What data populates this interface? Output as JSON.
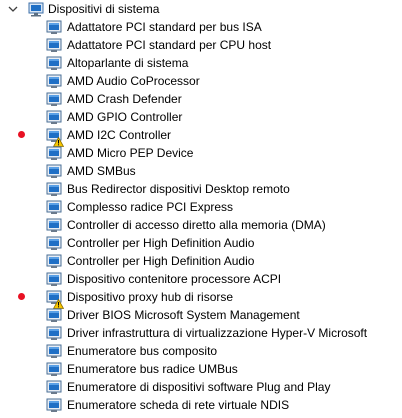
{
  "tree": {
    "category": {
      "label": "Dispositivi di sistema",
      "icon": "computer-chip-icon",
      "expanded": true
    },
    "colors": {
      "marker": "#e81123",
      "warning": "#f7c600",
      "icon_blue": "#1f6fc5"
    },
    "devices": [
      {
        "label": "Adattatore PCI standard per bus ISA",
        "warning": false,
        "marked": false
      },
      {
        "label": "Adattatore PCI standard per CPU host",
        "warning": false,
        "marked": false
      },
      {
        "label": "Altoparlante di sistema",
        "warning": false,
        "marked": false
      },
      {
        "label": "AMD Audio CoProcessor",
        "warning": false,
        "marked": false
      },
      {
        "label": "AMD Crash Defender",
        "warning": false,
        "marked": false
      },
      {
        "label": "AMD GPIO Controller",
        "warning": false,
        "marked": false
      },
      {
        "label": "AMD I2C Controller",
        "warning": true,
        "marked": true
      },
      {
        "label": "AMD Micro PEP Device",
        "warning": false,
        "marked": false
      },
      {
        "label": "AMD SMBus",
        "warning": false,
        "marked": false
      },
      {
        "label": "Bus Redirector dispositivi Desktop remoto",
        "warning": false,
        "marked": false
      },
      {
        "label": "Complesso radice PCI Express",
        "warning": false,
        "marked": false
      },
      {
        "label": "Controller di accesso diretto alla memoria (DMA)",
        "warning": false,
        "marked": false
      },
      {
        "label": "Controller per High Definition Audio",
        "warning": false,
        "marked": false
      },
      {
        "label": "Controller per High Definition Audio",
        "warning": false,
        "marked": false
      },
      {
        "label": "Dispositivo contenitore processore ACPI",
        "warning": false,
        "marked": false
      },
      {
        "label": "Dispositivo proxy hub di risorse",
        "warning": true,
        "marked": true
      },
      {
        "label": "Driver BIOS Microsoft System Management",
        "warning": false,
        "marked": false
      },
      {
        "label": "Driver infrastruttura di virtualizzazione Hyper-V Microsoft",
        "warning": false,
        "marked": false
      },
      {
        "label": "Enumeratore bus composito",
        "warning": false,
        "marked": false
      },
      {
        "label": "Enumeratore bus radice UMBus",
        "warning": false,
        "marked": false
      },
      {
        "label": "Enumeratore di dispositivi software Plug and Play",
        "warning": false,
        "marked": false
      },
      {
        "label": "Enumeratore scheda di rete virtuale NDIS",
        "warning": false,
        "marked": false
      }
    ]
  }
}
